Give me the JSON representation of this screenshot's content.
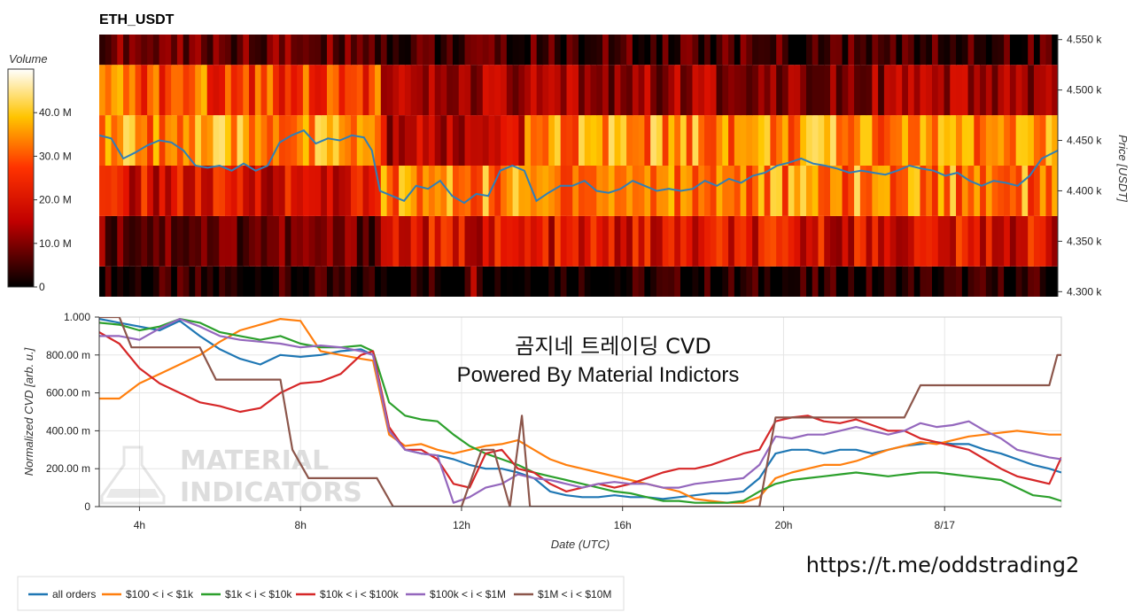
{
  "chart_data": [
    {
      "type": "heatmap",
      "title": "ETH_USDT",
      "ylabel": "Price [USDT]",
      "yticks": [
        "4.550 k",
        "4.500 k",
        "4.450 k",
        "4.400 k",
        "4.350 k",
        "4.300 k"
      ],
      "ylim": [
        4295,
        4555
      ],
      "colorbar": {
        "title": "Volume",
        "ticks": [
          "40.0 M",
          "30.0 M",
          "20.0 M",
          "10.0 M",
          "0"
        ],
        "range": [
          0,
          50
        ]
      },
      "price_line": {
        "x": [
          3.0,
          3.3,
          3.6,
          3.9,
          4.2,
          4.5,
          4.8,
          5.1,
          5.4,
          5.7,
          6.0,
          6.3,
          6.6,
          6.9,
          7.2,
          7.5,
          7.8,
          8.1,
          8.4,
          8.7,
          9.0,
          9.3,
          9.6,
          9.8,
          10.0,
          10.3,
          10.6,
          10.9,
          11.2,
          11.5,
          11.8,
          12.1,
          12.4,
          12.7,
          13.0,
          13.3,
          13.6,
          13.9,
          14.2,
          14.5,
          14.8,
          15.1,
          15.4,
          15.7,
          16.0,
          16.3,
          16.6,
          16.9,
          17.2,
          17.5,
          17.8,
          18.1,
          18.4,
          18.7,
          19.0,
          19.3,
          19.6,
          19.9,
          20.2,
          20.5,
          20.8,
          21.1,
          21.4,
          21.7,
          22.0,
          22.3,
          22.6,
          22.9,
          23.2,
          23.5,
          23.8,
          24.1,
          24.4,
          24.7,
          25.0,
          25.3,
          25.6,
          25.9,
          26.2,
          26.5,
          26.9
        ],
        "y": [
          4455,
          4452,
          4432,
          4438,
          4445,
          4450,
          4448,
          4440,
          4425,
          4423,
          4425,
          4420,
          4427,
          4420,
          4425,
          4448,
          4455,
          4460,
          4447,
          4452,
          4450,
          4455,
          4453,
          4440,
          4400,
          4395,
          4390,
          4405,
          4402,
          4410,
          4395,
          4388,
          4397,
          4395,
          4420,
          4425,
          4420,
          4390,
          4398,
          4405,
          4405,
          4410,
          4400,
          4398,
          4402,
          4410,
          4405,
          4400,
          4402,
          4400,
          4402,
          4410,
          4405,
          4412,
          4408,
          4415,
          4418,
          4425,
          4428,
          4432,
          4427,
          4425,
          4422,
          4418,
          4420,
          4418,
          4416,
          4420,
          4425,
          4422,
          4420,
          4415,
          4418,
          4410,
          4405,
          4410,
          4408,
          4405,
          4415,
          4432,
          4440
        ]
      },
      "rows": [
        {
          "low": 4295,
          "high": 4325
        },
        {
          "low": 4325,
          "high": 4375
        },
        {
          "low": 4375,
          "high": 4425
        },
        {
          "low": 4425,
          "high": 4475
        },
        {
          "low": 4475,
          "high": 4525
        },
        {
          "low": 4525,
          "high": 4555
        }
      ]
    },
    {
      "type": "line",
      "title": "곰지네 트레이딩 CVD",
      "subtitle": "Powered By Material Indictors",
      "xlabel": "Date (UTC)",
      "ylabel": "Normalized CVD [arb. u.]",
      "xticks": [
        "4h",
        "8h",
        "12h",
        "16h",
        "20h",
        "8/17"
      ],
      "xtick_values": [
        4,
        8,
        12,
        16,
        20,
        24
      ],
      "xlim": [
        3.0,
        26.9
      ],
      "yticks": [
        "1.000",
        "800.00 m",
        "600.00 m",
        "400.00 m",
        "200.00 m",
        "0"
      ],
      "ylim": [
        0,
        1.0
      ],
      "series": [
        {
          "name": "all orders",
          "color": "#1f77b4",
          "x": [
            3,
            3.5,
            4,
            4.5,
            5,
            5.5,
            6,
            6.5,
            7,
            7.5,
            8,
            8.5,
            9,
            9.5,
            9.8,
            10.2,
            10.6,
            11,
            11.4,
            11.8,
            12.2,
            12.6,
            13,
            13.4,
            13.8,
            14.2,
            14.6,
            15,
            15.4,
            15.8,
            16.2,
            16.6,
            17,
            17.4,
            17.8,
            18.2,
            18.6,
            19,
            19.4,
            19.8,
            20.2,
            20.6,
            21,
            21.4,
            21.8,
            22.2,
            22.6,
            23,
            23.4,
            23.8,
            24.2,
            24.6,
            25,
            25.4,
            25.8,
            26.2,
            26.6,
            26.9
          ],
          "y": [
            0.99,
            0.97,
            0.95,
            0.93,
            0.98,
            0.9,
            0.83,
            0.78,
            0.75,
            0.8,
            0.79,
            0.8,
            0.82,
            0.83,
            0.8,
            0.4,
            0.3,
            0.28,
            0.27,
            0.25,
            0.22,
            0.2,
            0.2,
            0.18,
            0.15,
            0.08,
            0.06,
            0.05,
            0.05,
            0.06,
            0.05,
            0.05,
            0.04,
            0.05,
            0.06,
            0.07,
            0.07,
            0.08,
            0.15,
            0.28,
            0.3,
            0.3,
            0.28,
            0.3,
            0.3,
            0.28,
            0.3,
            0.32,
            0.33,
            0.34,
            0.33,
            0.33,
            0.3,
            0.28,
            0.25,
            0.22,
            0.2,
            0.18
          ]
        },
        {
          "name": "$100 < i < $1k",
          "color": "#ff7f0e",
          "x": [
            3,
            3.5,
            4,
            4.5,
            5,
            5.5,
            6,
            6.5,
            7,
            7.5,
            8,
            8.5,
            9,
            9.5,
            9.8,
            10.2,
            10.6,
            11,
            11.4,
            11.8,
            12.2,
            12.6,
            13,
            13.4,
            13.8,
            14.2,
            14.6,
            15,
            15.4,
            15.8,
            16.2,
            16.6,
            17,
            17.4,
            17.8,
            18.2,
            18.6,
            19,
            19.4,
            19.8,
            20.2,
            20.6,
            21,
            21.4,
            21.8,
            22.2,
            22.6,
            23,
            23.4,
            23.8,
            24.2,
            24.6,
            25,
            25.4,
            25.8,
            26.2,
            26.6,
            26.9
          ],
          "y": [
            0.57,
            0.57,
            0.65,
            0.7,
            0.75,
            0.8,
            0.87,
            0.93,
            0.96,
            0.99,
            0.98,
            0.82,
            0.8,
            0.78,
            0.77,
            0.38,
            0.32,
            0.33,
            0.3,
            0.28,
            0.3,
            0.32,
            0.33,
            0.35,
            0.3,
            0.25,
            0.22,
            0.2,
            0.18,
            0.16,
            0.14,
            0.12,
            0.1,
            0.08,
            0.04,
            0.03,
            0.02,
            0.02,
            0.05,
            0.15,
            0.18,
            0.2,
            0.22,
            0.22,
            0.24,
            0.27,
            0.3,
            0.32,
            0.34,
            0.33,
            0.35,
            0.37,
            0.38,
            0.39,
            0.4,
            0.39,
            0.38,
            0.38
          ]
        },
        {
          "name": "$1k < i < $10k",
          "color": "#2ca02c",
          "x": [
            3,
            3.5,
            4,
            4.5,
            5,
            5.5,
            6,
            6.5,
            7,
            7.5,
            8,
            8.5,
            9,
            9.5,
            9.8,
            10.2,
            10.6,
            11,
            11.4,
            11.8,
            12.2,
            12.6,
            13,
            13.4,
            13.8,
            14.2,
            14.6,
            15,
            15.4,
            15.8,
            16.2,
            16.6,
            17,
            17.4,
            17.8,
            18.2,
            18.6,
            19,
            19.4,
            19.8,
            20.2,
            20.6,
            21,
            21.4,
            21.8,
            22.2,
            22.6,
            23,
            23.4,
            23.8,
            24.2,
            24.6,
            25,
            25.4,
            25.8,
            26.2,
            26.6,
            26.9
          ],
          "y": [
            0.97,
            0.96,
            0.93,
            0.95,
            0.99,
            0.97,
            0.92,
            0.9,
            0.88,
            0.9,
            0.86,
            0.84,
            0.84,
            0.85,
            0.82,
            0.55,
            0.48,
            0.46,
            0.45,
            0.38,
            0.32,
            0.28,
            0.25,
            0.22,
            0.18,
            0.16,
            0.14,
            0.12,
            0.1,
            0.08,
            0.07,
            0.05,
            0.03,
            0.03,
            0.02,
            0.02,
            0.02,
            0.03,
            0.08,
            0.12,
            0.14,
            0.15,
            0.16,
            0.17,
            0.18,
            0.17,
            0.16,
            0.17,
            0.18,
            0.18,
            0.17,
            0.16,
            0.15,
            0.14,
            0.1,
            0.06,
            0.05,
            0.03
          ]
        },
        {
          "name": "$10k < i < $100k",
          "color": "#d62728",
          "x": [
            3,
            3.5,
            4,
            4.5,
            5,
            5.5,
            6,
            6.5,
            7,
            7.5,
            8,
            8.5,
            9,
            9.5,
            9.8,
            10.2,
            10.6,
            11,
            11.4,
            11.8,
            12.2,
            12.6,
            13,
            13.4,
            13.8,
            14.2,
            14.6,
            15,
            15.4,
            15.8,
            16.2,
            16.6,
            17,
            17.4,
            17.8,
            18.2,
            18.6,
            19,
            19.4,
            19.8,
            20.2,
            20.6,
            21,
            21.4,
            21.8,
            22.2,
            22.6,
            23,
            23.4,
            23.8,
            24.2,
            24.6,
            25,
            25.4,
            25.8,
            26.2,
            26.6,
            26.9
          ],
          "y": [
            0.92,
            0.86,
            0.73,
            0.65,
            0.6,
            0.55,
            0.53,
            0.5,
            0.52,
            0.6,
            0.65,
            0.66,
            0.7,
            0.8,
            0.82,
            0.42,
            0.3,
            0.3,
            0.25,
            0.12,
            0.1,
            0.28,
            0.3,
            0.2,
            0.18,
            0.12,
            0.08,
            0.1,
            0.12,
            0.1,
            0.12,
            0.15,
            0.18,
            0.2,
            0.2,
            0.22,
            0.25,
            0.28,
            0.3,
            0.45,
            0.47,
            0.48,
            0.45,
            0.44,
            0.46,
            0.43,
            0.4,
            0.4,
            0.36,
            0.34,
            0.32,
            0.3,
            0.25,
            0.2,
            0.16,
            0.14,
            0.12,
            0.26
          ]
        },
        {
          "name": "$100k < i < $1M",
          "color": "#9467bd",
          "x": [
            3,
            3.5,
            4,
            4.5,
            5,
            5.5,
            6,
            6.5,
            7,
            7.5,
            8,
            8.5,
            9,
            9.5,
            9.8,
            10.2,
            10.6,
            11,
            11.4,
            11.8,
            12.2,
            12.6,
            13,
            13.4,
            13.8,
            14.2,
            14.6,
            15,
            15.4,
            15.8,
            16.2,
            16.6,
            17,
            17.4,
            17.8,
            18.2,
            18.6,
            19,
            19.4,
            19.8,
            20.2,
            20.6,
            21,
            21.4,
            21.8,
            22.2,
            22.6,
            23,
            23.4,
            23.8,
            24.2,
            24.6,
            25,
            25.4,
            25.8,
            26.2,
            26.6,
            26.9
          ],
          "y": [
            0.9,
            0.9,
            0.88,
            0.94,
            0.99,
            0.95,
            0.9,
            0.88,
            0.87,
            0.86,
            0.84,
            0.85,
            0.84,
            0.82,
            0.8,
            0.4,
            0.3,
            0.28,
            0.27,
            0.02,
            0.05,
            0.1,
            0.12,
            0.17,
            0.15,
            0.14,
            0.12,
            0.1,
            0.12,
            0.13,
            0.12,
            0.12,
            0.1,
            0.1,
            0.12,
            0.13,
            0.14,
            0.15,
            0.22,
            0.37,
            0.36,
            0.38,
            0.38,
            0.4,
            0.42,
            0.4,
            0.38,
            0.4,
            0.44,
            0.42,
            0.43,
            0.45,
            0.4,
            0.36,
            0.3,
            0.28,
            0.26,
            0.25
          ]
        },
        {
          "name": "$1M < i < $10M",
          "color": "#8c564b",
          "x": [
            3,
            3.5,
            3.8,
            4.5,
            5,
            5.5,
            5.9,
            6.5,
            7,
            7.5,
            7.8,
            8.2,
            9,
            9.5,
            9.9,
            10.3,
            11,
            11.5,
            12,
            12.5,
            12.8,
            13.2,
            13.5,
            13.7,
            13.9,
            14.5,
            15,
            16,
            17,
            18,
            19,
            19.4,
            19.8,
            20.5,
            21,
            21.5,
            22,
            23,
            23.4,
            24,
            25,
            26,
            26.6,
            26.8,
            26.9
          ],
          "y": [
            1.0,
            1.0,
            0.84,
            0.84,
            0.84,
            0.84,
            0.67,
            0.67,
            0.67,
            0.67,
            0.3,
            0.15,
            0.15,
            0.15,
            0.15,
            0.0,
            0.0,
            0.0,
            0.0,
            0.3,
            0.3,
            0.0,
            0.48,
            0.0,
            0.0,
            0.0,
            0.0,
            0.0,
            0.0,
            0.0,
            0.0,
            0.0,
            0.47,
            0.47,
            0.47,
            0.47,
            0.47,
            0.47,
            0.64,
            0.64,
            0.64,
            0.64,
            0.64,
            0.8,
            0.8
          ]
        }
      ]
    }
  ],
  "watermark": {
    "line1": "MATERIAL",
    "line2": "INDICATORS"
  },
  "link_text": "https://t.me/oddstrading2",
  "legend_items": [
    "all orders",
    "$100 < i < $1k",
    "$1k < i < $10k",
    "$10k < i < $100k",
    "$100k < i < $1M",
    "$1M < i < $10M"
  ]
}
